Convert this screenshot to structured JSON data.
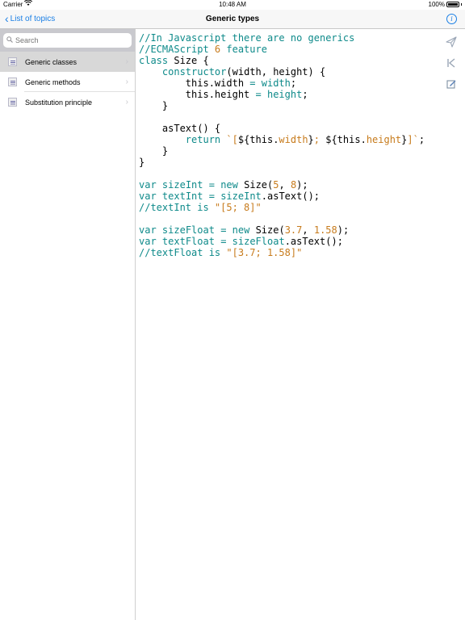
{
  "status": {
    "carrier": "Carrier",
    "time": "10:48 AM",
    "battery": "100%"
  },
  "nav": {
    "back_label": "List of topics",
    "title": "Generic types",
    "info_icon": "info-icon"
  },
  "sidebar": {
    "search_placeholder": "Search",
    "items": [
      {
        "label": "Generic classes",
        "selected": true
      },
      {
        "label": "Generic methods",
        "selected": false
      },
      {
        "label": "Substitution principle",
        "selected": false
      }
    ]
  },
  "code": {
    "lines": [
      [
        [
          "//In Javascript there are no generics",
          "com"
        ]
      ],
      [
        [
          "//ECMAScript ",
          "com"
        ],
        [
          "6",
          "num"
        ],
        [
          " feature",
          "com"
        ]
      ],
      [
        [
          "class",
          "kw"
        ],
        [
          " Size {",
          ""
        ]
      ],
      [
        [
          "    ",
          ""
        ],
        [
          "constructor",
          "kw"
        ],
        [
          "(width, height) {",
          ""
        ]
      ],
      [
        [
          "        this.width ",
          ""
        ],
        [
          "=",
          "kw"
        ],
        [
          " ",
          ""
        ],
        [
          "width",
          "kw"
        ],
        [
          ";",
          ""
        ]
      ],
      [
        [
          "        this.height ",
          ""
        ],
        [
          "=",
          "kw"
        ],
        [
          " ",
          ""
        ],
        [
          "height",
          "kw"
        ],
        [
          ";",
          ""
        ]
      ],
      [
        [
          "    }",
          ""
        ]
      ],
      [
        [
          "",
          ""
        ]
      ],
      [
        [
          "    asText() {",
          ""
        ]
      ],
      [
        [
          "        ",
          ""
        ],
        [
          "return",
          "kw"
        ],
        [
          " ",
          ""
        ],
        [
          "`[",
          "str"
        ],
        [
          "${this.",
          ""
        ],
        [
          "width",
          "str"
        ],
        [
          "}",
          ""
        ],
        [
          "; ",
          "str"
        ],
        [
          "${this.",
          ""
        ],
        [
          "height",
          "str"
        ],
        [
          "}",
          ""
        ],
        [
          "]`",
          "str"
        ],
        [
          ";",
          ""
        ]
      ],
      [
        [
          "    }",
          ""
        ]
      ],
      [
        [
          "}",
          ""
        ]
      ],
      [
        [
          "",
          ""
        ]
      ],
      [
        [
          "var",
          "kw"
        ],
        [
          " ",
          ""
        ],
        [
          "sizeInt",
          "kw"
        ],
        [
          " ",
          ""
        ],
        [
          "=",
          "kw"
        ],
        [
          " ",
          ""
        ],
        [
          "new",
          "kw"
        ],
        [
          " Size(",
          ""
        ],
        [
          "5",
          "num"
        ],
        [
          ", ",
          ""
        ],
        [
          "8",
          "num"
        ],
        [
          ");",
          ""
        ]
      ],
      [
        [
          "var",
          "kw"
        ],
        [
          " ",
          ""
        ],
        [
          "textInt",
          "kw"
        ],
        [
          " ",
          ""
        ],
        [
          "=",
          "kw"
        ],
        [
          " ",
          ""
        ],
        [
          "sizeInt",
          "kw"
        ],
        [
          ".asText();",
          ""
        ]
      ],
      [
        [
          "//textInt is ",
          "com"
        ],
        [
          "\"[5; 8]\"",
          "str"
        ]
      ],
      [
        [
          "",
          ""
        ]
      ],
      [
        [
          "var",
          "kw"
        ],
        [
          " ",
          ""
        ],
        [
          "sizeFloat",
          "kw"
        ],
        [
          " ",
          ""
        ],
        [
          "=",
          "kw"
        ],
        [
          " ",
          ""
        ],
        [
          "new",
          "kw"
        ],
        [
          " Size(",
          ""
        ],
        [
          "3.7",
          "num"
        ],
        [
          ", ",
          ""
        ],
        [
          "1.58",
          "num"
        ],
        [
          ");",
          ""
        ]
      ],
      [
        [
          "var",
          "kw"
        ],
        [
          " ",
          ""
        ],
        [
          "textFloat",
          "kw"
        ],
        [
          " ",
          ""
        ],
        [
          "=",
          "kw"
        ],
        [
          " ",
          ""
        ],
        [
          "sizeFloat",
          "kw"
        ],
        [
          ".asText();",
          ""
        ]
      ],
      [
        [
          "//textFloat is ",
          "com"
        ],
        [
          "\"[3.7; 1.58]\"",
          "str"
        ]
      ]
    ]
  },
  "toolbar": {
    "icons": [
      "send-icon",
      "skip-back-icon",
      "edit-icon"
    ]
  },
  "colors": {
    "accent": "#1a7fe5",
    "comment": "#0e8a8a",
    "number": "#c77b1c",
    "selection": "#d8d8d8"
  }
}
